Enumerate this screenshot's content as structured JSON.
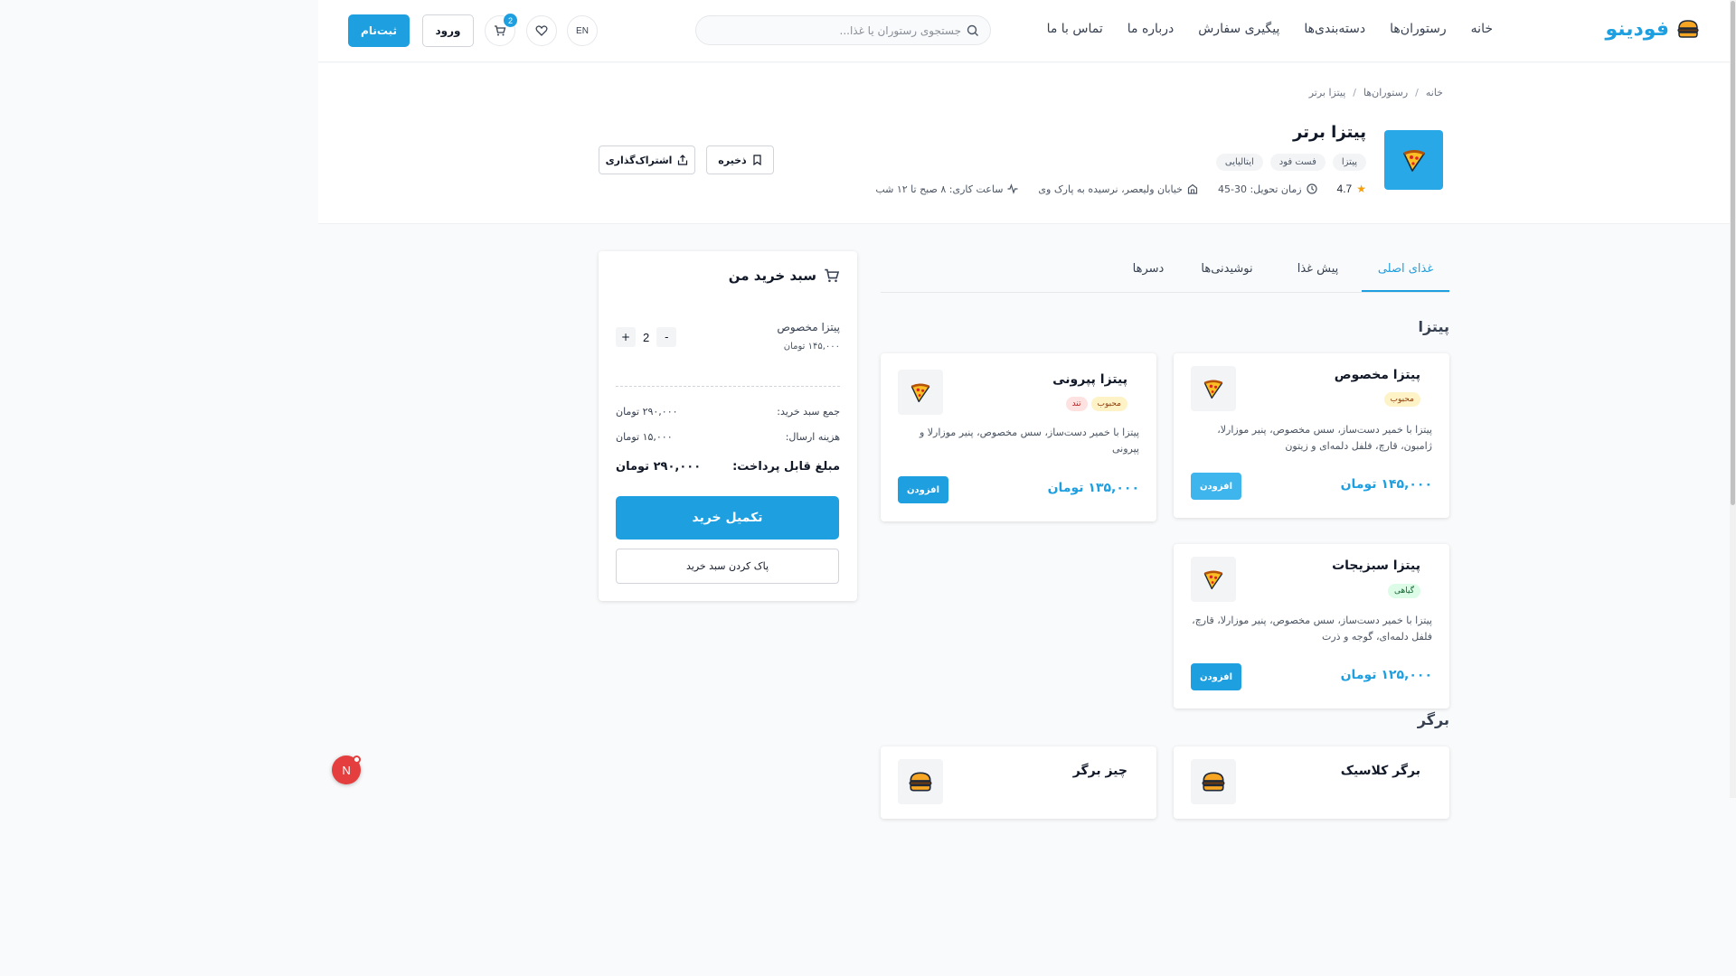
{
  "header": {
    "logo_text": "فودینو",
    "nav": [
      "خانه",
      "رستوران‌ها",
      "دسته‌بندی‌ها",
      "پیگیری سفارش",
      "درباره ما",
      "تماس با ما"
    ],
    "search_placeholder": "جستجوی رستوران یا غذا...",
    "lang": "EN",
    "cart_count": "2",
    "login": "ورود",
    "signup": "ثبت‌نام",
    "accent_color": "#1e9fe0"
  },
  "breadcrumb": [
    "خانه",
    "رستوران‌ها",
    "پیتزا برتر"
  ],
  "restaurant": {
    "name": "پیتزا برتر",
    "tags": [
      "پیتزا",
      "فست فود",
      "ایتالیایی"
    ],
    "rating": "4.7",
    "delivery": "زمان تحویل: 30-45",
    "address": "خیابان ولیعصر، نرسیده به پارک وی",
    "hours": "ساعت کاری: ۸ صبح تا ۱۲ شب",
    "save": "ذخیره",
    "share": "اشتراک‌گذاری"
  },
  "tabs": [
    "غذای اصلی",
    "پیش غذا",
    "نوشیدنی‌ها",
    "دسرها"
  ],
  "sections": {
    "pizza": "پیتزا",
    "burger": "برگر"
  },
  "foods": [
    {
      "name": "پیتزا مخصوص",
      "badges": [
        "محبوب"
      ],
      "desc": "پیتزا با خمیر دست‌ساز، سس مخصوص، پنیر موزارلا، ژامبون، قارچ، فلفل دلمه‌ای و زیتون",
      "price": "۱۴۵,۰۰۰ تومان",
      "add": "افزودن",
      "icon": "pizza-icon"
    },
    {
      "name": "پیتزا پپرونی",
      "badges": [
        "محبوب",
        "تند"
      ],
      "desc": "پیتزا با خمیر دست‌ساز، سس مخصوص، پنیر موزارلا و پپرونی",
      "price": "۱۳۵,۰۰۰ تومان",
      "add": "افزودن",
      "icon": "pizza-icon"
    },
    {
      "name": "پیتزا سبزیجات",
      "badges": [
        "گیاهی"
      ],
      "desc": "پیتزا با خمیر دست‌ساز، سس مخصوص، پنیر موزارلا، قارچ، فلفل دلمه‌ای، گوجه و ذرت",
      "price": "۱۲۵,۰۰۰ تومان",
      "add": "افزودن",
      "icon": "pizza-icon"
    },
    {
      "name": "برگر کلاسیک",
      "icon": "burger-icon"
    },
    {
      "name": "چیز برگر",
      "icon": "burger-icon"
    }
  ],
  "cart": {
    "title": "سبد خرید من",
    "item_name": "پیتزا مخصوص",
    "item_price": "۱۴۵,۰۰۰ تومان",
    "qty": "2",
    "minus": "-",
    "plus": "+",
    "subtotal_label": "جمع سبد خرید:",
    "subtotal": "۲۹۰,۰۰۰ تومان",
    "shipping_label": "هزینه ارسال:",
    "shipping": "۱۵,۰۰۰ تومان",
    "total_label": "مبلغ قابل پرداخت:",
    "total": "۲۹۰,۰۰۰ تومان",
    "checkout": "تکمیل خرید",
    "clear": "پاک کردن سبد خرید"
  },
  "floating_badge": "N"
}
